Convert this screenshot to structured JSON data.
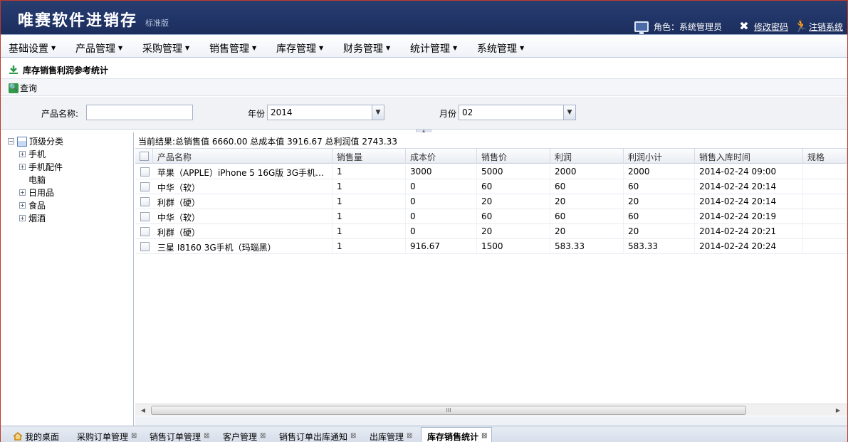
{
  "header": {
    "app_title": "唯赛软件进销存",
    "edition": "标准版",
    "role_text": "角色：系统管理员",
    "change_password": "修改密码",
    "logout": "注销系统"
  },
  "menu": [
    {
      "label": "基础设置"
    },
    {
      "label": "产品管理"
    },
    {
      "label": "采购管理"
    },
    {
      "label": "销售管理"
    },
    {
      "label": "库存管理"
    },
    {
      "label": "财务管理"
    },
    {
      "label": "统计管理"
    },
    {
      "label": "系统管理"
    }
  ],
  "page": {
    "title": "库存销售利润参考统计",
    "search_label": "查询"
  },
  "filters": {
    "product_label": "产品名称:",
    "product_value": "",
    "year_label": "年份",
    "year_value": "2014",
    "month_label": "月份",
    "month_value": "02"
  },
  "tree": {
    "root": "顶级分类",
    "nodes": [
      "手机",
      "手机配件",
      "电脑",
      "日用品",
      "食品",
      "烟酒"
    ]
  },
  "grid": {
    "summary": "当前结果:总销售值 6660.00 总成本值 3916.67 总利润值 2743.33",
    "columns": [
      "产品名称",
      "销售量",
      "成本价",
      "销售价",
      "利润",
      "利润小计",
      "销售入库时间",
      "规格"
    ],
    "rows": [
      [
        "苹果（APPLE）iPhone 5 16G版 3G手机（…",
        "1",
        "3000",
        "5000",
        "2000",
        "2000",
        "2014-02-24 09:00",
        ""
      ],
      [
        "中华（软）",
        "1",
        "0",
        "60",
        "60",
        "60",
        "2014-02-24 20:14",
        ""
      ],
      [
        "利群（硬）",
        "1",
        "0",
        "20",
        "20",
        "20",
        "2014-02-24 20:14",
        ""
      ],
      [
        "中华（软）",
        "1",
        "0",
        "60",
        "60",
        "60",
        "2014-02-24 20:19",
        ""
      ],
      [
        "利群（硬）",
        "1",
        "0",
        "20",
        "20",
        "20",
        "2014-02-24 20:21",
        ""
      ],
      [
        "三星 I8160 3G手机（玛瑙黑）",
        "1",
        "916.67",
        "1500",
        "583.33",
        "583.33",
        "2014-02-24 20:24",
        ""
      ]
    ],
    "scroll_grip": "III"
  },
  "tabs": [
    {
      "label": "我的桌面",
      "closable": false
    },
    {
      "label": "采购订单管理",
      "closable": true
    },
    {
      "label": "销售订单管理",
      "closable": true
    },
    {
      "label": "客户管理",
      "closable": true
    },
    {
      "label": "销售订单出库通知",
      "closable": true
    },
    {
      "label": "出库管理",
      "closable": true
    },
    {
      "label": "库存销售统计",
      "closable": true,
      "active": true
    }
  ],
  "colors": {
    "header_bg": "#22366a",
    "accent": "#2f9a4a"
  }
}
